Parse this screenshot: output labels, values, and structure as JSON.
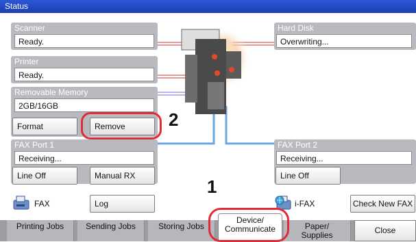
{
  "title": "Status",
  "scanner": {
    "title": "Scanner",
    "status": "Ready."
  },
  "printer": {
    "title": "Printer",
    "status": "Ready."
  },
  "removable": {
    "title": "Removable Memory",
    "capacity": "2GB/16GB",
    "format_label": "Format",
    "remove_label": "Remove"
  },
  "harddisk": {
    "title": "Hard Disk",
    "status": "Overwriting..."
  },
  "fax1": {
    "title": "FAX Port 1",
    "status": "Receiving...",
    "lineoff_label": "Line Off",
    "manualrx_label": "Manual RX"
  },
  "fax2": {
    "title": "FAX Port 2",
    "status": "Receiving...",
    "lineoff_label": "Line Off"
  },
  "fax_row": {
    "fax_label": "FAX",
    "log_label": "Log",
    "ifax_label": "i-FAX",
    "check_label": "Check New FAX"
  },
  "callouts": {
    "one": "1",
    "two": "2"
  },
  "tabs": [
    {
      "label": "Printing Jobs"
    },
    {
      "label": "Sending Jobs"
    },
    {
      "label": "Storing Jobs"
    },
    {
      "label": "Device/\nCommunicate"
    },
    {
      "label": "Paper/\nSupplies"
    },
    {
      "label": "Close"
    }
  ],
  "icons": {
    "device": "printer-device-icon",
    "fax": "fax-icon",
    "ifax": "ifax-icon"
  },
  "colors": {
    "titlebar": "#1b3fb4",
    "panel": "#b9babf",
    "callout_ring": "#e02b3a",
    "wire_blue": "#6aa7e0"
  }
}
